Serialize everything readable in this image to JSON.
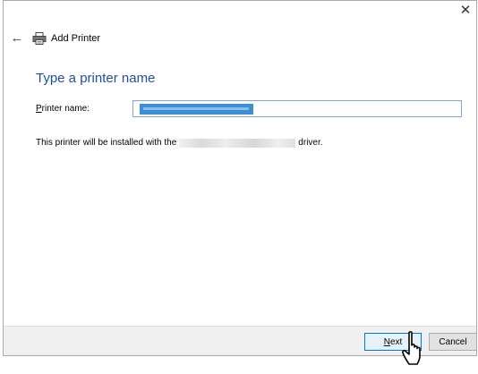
{
  "window": {
    "title": "Add Printer",
    "close_glyph": "✕",
    "back_glyph": "←"
  },
  "main": {
    "heading": "Type a printer name",
    "printer_name_label_accesskey": "P",
    "printer_name_label_rest": "rinter name:",
    "install_text_before": "This printer will be installed with the",
    "install_text_after": "driver."
  },
  "footer": {
    "next_accesskey": "N",
    "next_rest": "ext",
    "cancel_label": "Cancel"
  },
  "colors": {
    "heading": "#1e4e9e",
    "selection": "#3b8fd6",
    "primary_button_border": "#0078d7"
  },
  "icons": [
    "back-arrow-icon",
    "printer-icon",
    "close-icon",
    "mouse-pointer-icon"
  ]
}
